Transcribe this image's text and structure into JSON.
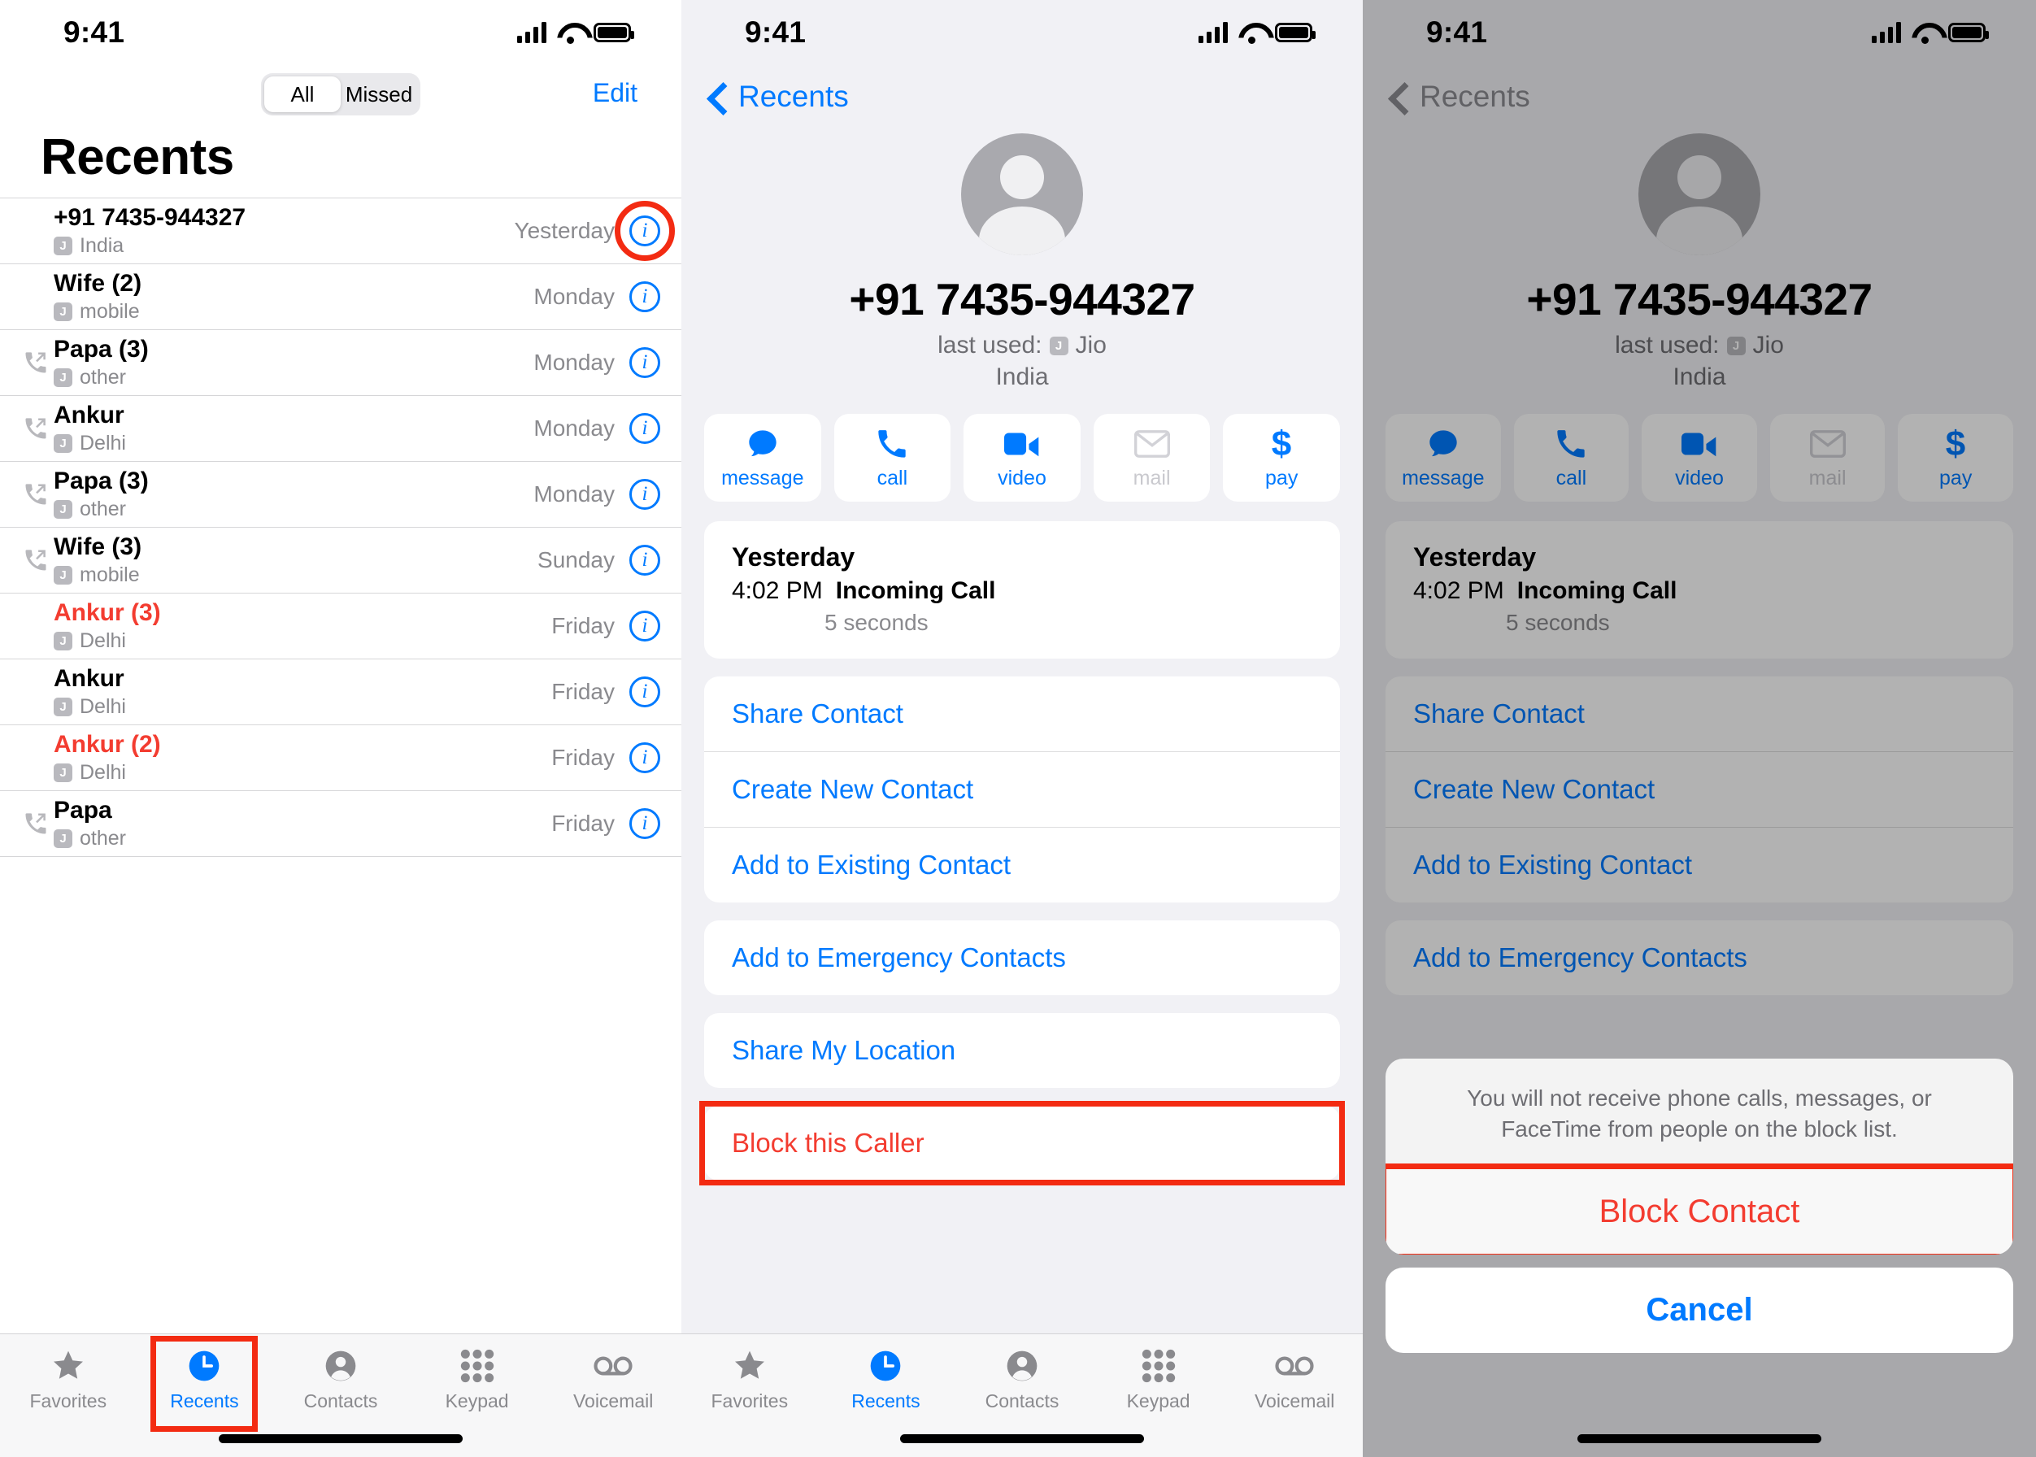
{
  "status_bar": {
    "time": "9:41",
    "wifi_icon": "wifi-icon",
    "battery_icon": "battery-icon",
    "signal_icon": "cellular-signal-icon"
  },
  "panel1": {
    "segmented": {
      "options": [
        "All",
        "Missed"
      ],
      "selected": "All"
    },
    "edit_label": "Edit",
    "title": "Recents",
    "carrier_badge": "J",
    "calls": [
      {
        "name": "+91 7435-944327",
        "label": "India",
        "when": "Yesterday",
        "direction": "none",
        "missed": false,
        "annotated": true
      },
      {
        "name": "Wife (2)",
        "label": "mobile",
        "when": "Monday",
        "direction": "none",
        "missed": false,
        "annotated": false
      },
      {
        "name": "Papa (3)",
        "label": "other",
        "when": "Monday",
        "direction": "outgoing",
        "missed": false,
        "annotated": false
      },
      {
        "name": "Ankur",
        "label": "Delhi",
        "when": "Monday",
        "direction": "outgoing",
        "missed": false,
        "annotated": false
      },
      {
        "name": "Papa (3)",
        "label": "other",
        "when": "Monday",
        "direction": "outgoing",
        "missed": false,
        "annotated": false
      },
      {
        "name": "Wife (3)",
        "label": "mobile",
        "when": "Sunday",
        "direction": "outgoing",
        "missed": false,
        "annotated": false
      },
      {
        "name": "Ankur (3)",
        "label": "Delhi",
        "when": "Friday",
        "direction": "none",
        "missed": true,
        "annotated": false
      },
      {
        "name": "Ankur",
        "label": "Delhi",
        "when": "Friday",
        "direction": "none",
        "missed": false,
        "annotated": false
      },
      {
        "name": "Ankur (2)",
        "label": "Delhi",
        "when": "Friday",
        "direction": "none",
        "missed": true,
        "annotated": false
      },
      {
        "name": "Papa",
        "label": "other",
        "when": "Friday",
        "direction": "outgoing",
        "missed": false,
        "annotated": false
      }
    ],
    "tabs": [
      {
        "label": "Favorites",
        "icon": "star-icon",
        "active": false,
        "annotated": false
      },
      {
        "label": "Recents",
        "icon": "clock-icon",
        "active": true,
        "annotated": true
      },
      {
        "label": "Contacts",
        "icon": "person-icon",
        "active": false,
        "annotated": false
      },
      {
        "label": "Keypad",
        "icon": "keypad-icon",
        "active": false,
        "annotated": false
      },
      {
        "label": "Voicemail",
        "icon": "voicemail-icon",
        "active": false,
        "annotated": false
      }
    ]
  },
  "panel2": {
    "back_label": "Recents",
    "number": "+91 7435-944327",
    "last_used_prefix": "last used:",
    "carrier_badge": "J",
    "carrier": "Jio",
    "country": "India",
    "actions": [
      {
        "label": "message",
        "icon": "message-bubble-icon",
        "disabled": false
      },
      {
        "label": "call",
        "icon": "phone-icon",
        "disabled": false
      },
      {
        "label": "video",
        "icon": "video-camera-icon",
        "disabled": false
      },
      {
        "label": "mail",
        "icon": "envelope-icon",
        "disabled": true
      },
      {
        "label": "pay",
        "icon": "dollar-icon",
        "disabled": false
      }
    ],
    "history": {
      "date": "Yesterday",
      "time": "4:02 PM",
      "type": "Incoming Call",
      "duration": "5 seconds"
    },
    "menu_group_1": [
      "Share Contact",
      "Create New Contact",
      "Add to Existing Contact"
    ],
    "menu_group_2": [
      "Add to Emergency Contacts"
    ],
    "menu_group_3": [
      "Share My Location"
    ],
    "block_label": "Block this Caller"
  },
  "panel3": {
    "back_label": "Recents",
    "number": "+91 7435-944327",
    "last_used_prefix": "last used:",
    "carrier_badge": "J",
    "carrier": "Jio",
    "country": "India",
    "actions": [
      {
        "label": "message",
        "icon": "message-bubble-icon"
      },
      {
        "label": "call",
        "icon": "phone-icon"
      },
      {
        "label": "video",
        "icon": "video-camera-icon"
      },
      {
        "label": "mail",
        "icon": "envelope-icon"
      },
      {
        "label": "pay",
        "icon": "dollar-icon"
      }
    ],
    "history": {
      "date": "Yesterday",
      "time": "4:02 PM",
      "type": "Incoming Call",
      "duration": "5 seconds"
    },
    "menu_group_1": [
      "Share Contact",
      "Create New Contact",
      "Add to Existing Contact"
    ],
    "menu_group_2": [
      "Add to Emergency Contacts"
    ],
    "sheet": {
      "message": "You will not receive phone calls, messages, or FaceTime from people on the block list.",
      "confirm_label": "Block Contact",
      "cancel_label": "Cancel"
    }
  },
  "colors": {
    "accent_blue": "#007aff",
    "missed_red": "#f33c30",
    "annotation_red": "#f32b12",
    "panel_bg": "#f1f1f5",
    "subtle_gray": "#8a8a8e"
  }
}
